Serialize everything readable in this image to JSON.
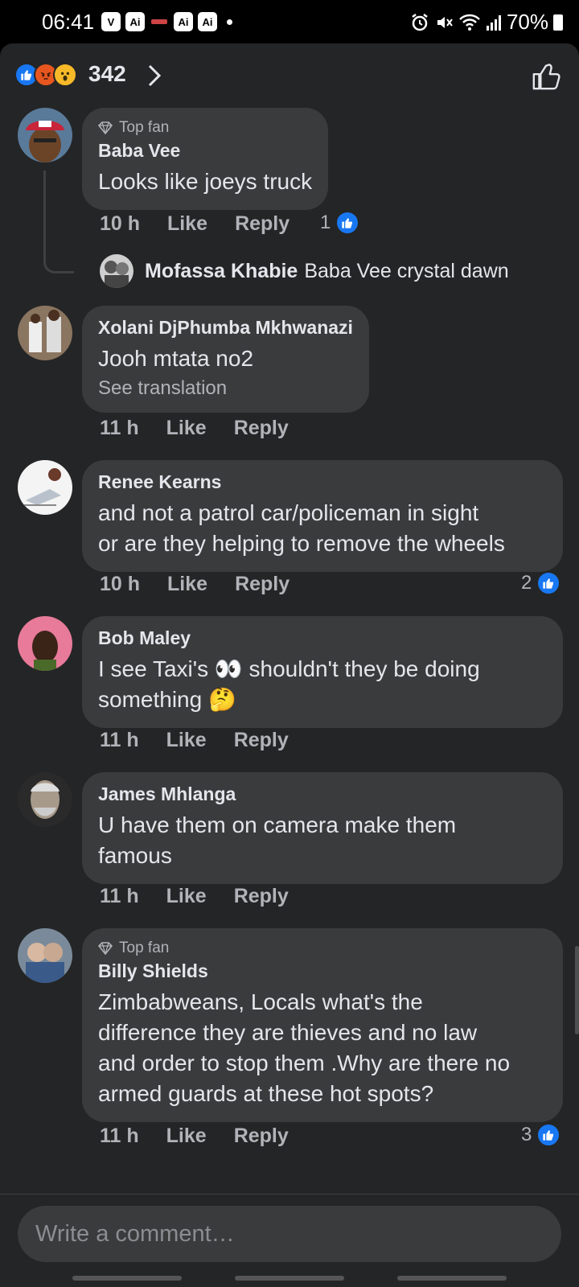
{
  "status": {
    "time": "06:41",
    "icons": [
      "Ai",
      "Ai",
      "Ai"
    ],
    "battery": "70%"
  },
  "reactions": {
    "count": "342",
    "types": [
      "like-icon",
      "angry-icon",
      "wow-icon"
    ]
  },
  "comments": [
    {
      "badge": "Top fan",
      "name": "Baba Vee",
      "text": [
        "Looks like joeys truck"
      ],
      "time": "10 h",
      "like": "Like",
      "reply": "Reply",
      "likes": "1"
    },
    {
      "badge": "",
      "name": "Xolani DjPhumba Mkhwanazi",
      "text": [
        "Jooh mtata no2"
      ],
      "translation": "See translation",
      "time": "11 h",
      "like": "Like",
      "reply": "Reply",
      "likes": ""
    },
    {
      "badge": "",
      "name": "Renee Kearns",
      "text": [
        "and not a patrol car/policeman in sight",
        "or are they helping to remove the wheels"
      ],
      "time": "10 h",
      "like": "Like",
      "reply": "Reply",
      "likes": "2"
    },
    {
      "badge": "",
      "name": "Bob Maley",
      "text": [
        "I see Taxi's 👀 shouldn't they be doing",
        "something 🤔"
      ],
      "time": "11 h",
      "like": "Like",
      "reply": "Reply",
      "likes": ""
    },
    {
      "badge": "",
      "name": "James Mhlanga",
      "text": [
        "U have them on camera make them",
        "famous"
      ],
      "time": "11 h",
      "like": "Like",
      "reply": "Reply",
      "likes": ""
    },
    {
      "badge": "Top fan",
      "name": "Billy Shields",
      "text": [
        "Zimbabweans, Locals what's the",
        "difference they are thieves and no law",
        "and order to stop them .Why are there no",
        "armed guards at these hot spots?"
      ],
      "time": "11 h",
      "like": "Like",
      "reply": "Reply",
      "likes": "3"
    }
  ],
  "reply_preview": {
    "name": "Mofassa Khabie",
    "text": "Baba Vee crystal dawn"
  },
  "composer": {
    "placeholder": "Write a comment…"
  },
  "colors": {
    "background": "#242526",
    "bubble": "#3a3b3c",
    "accent": "#1877f2"
  }
}
